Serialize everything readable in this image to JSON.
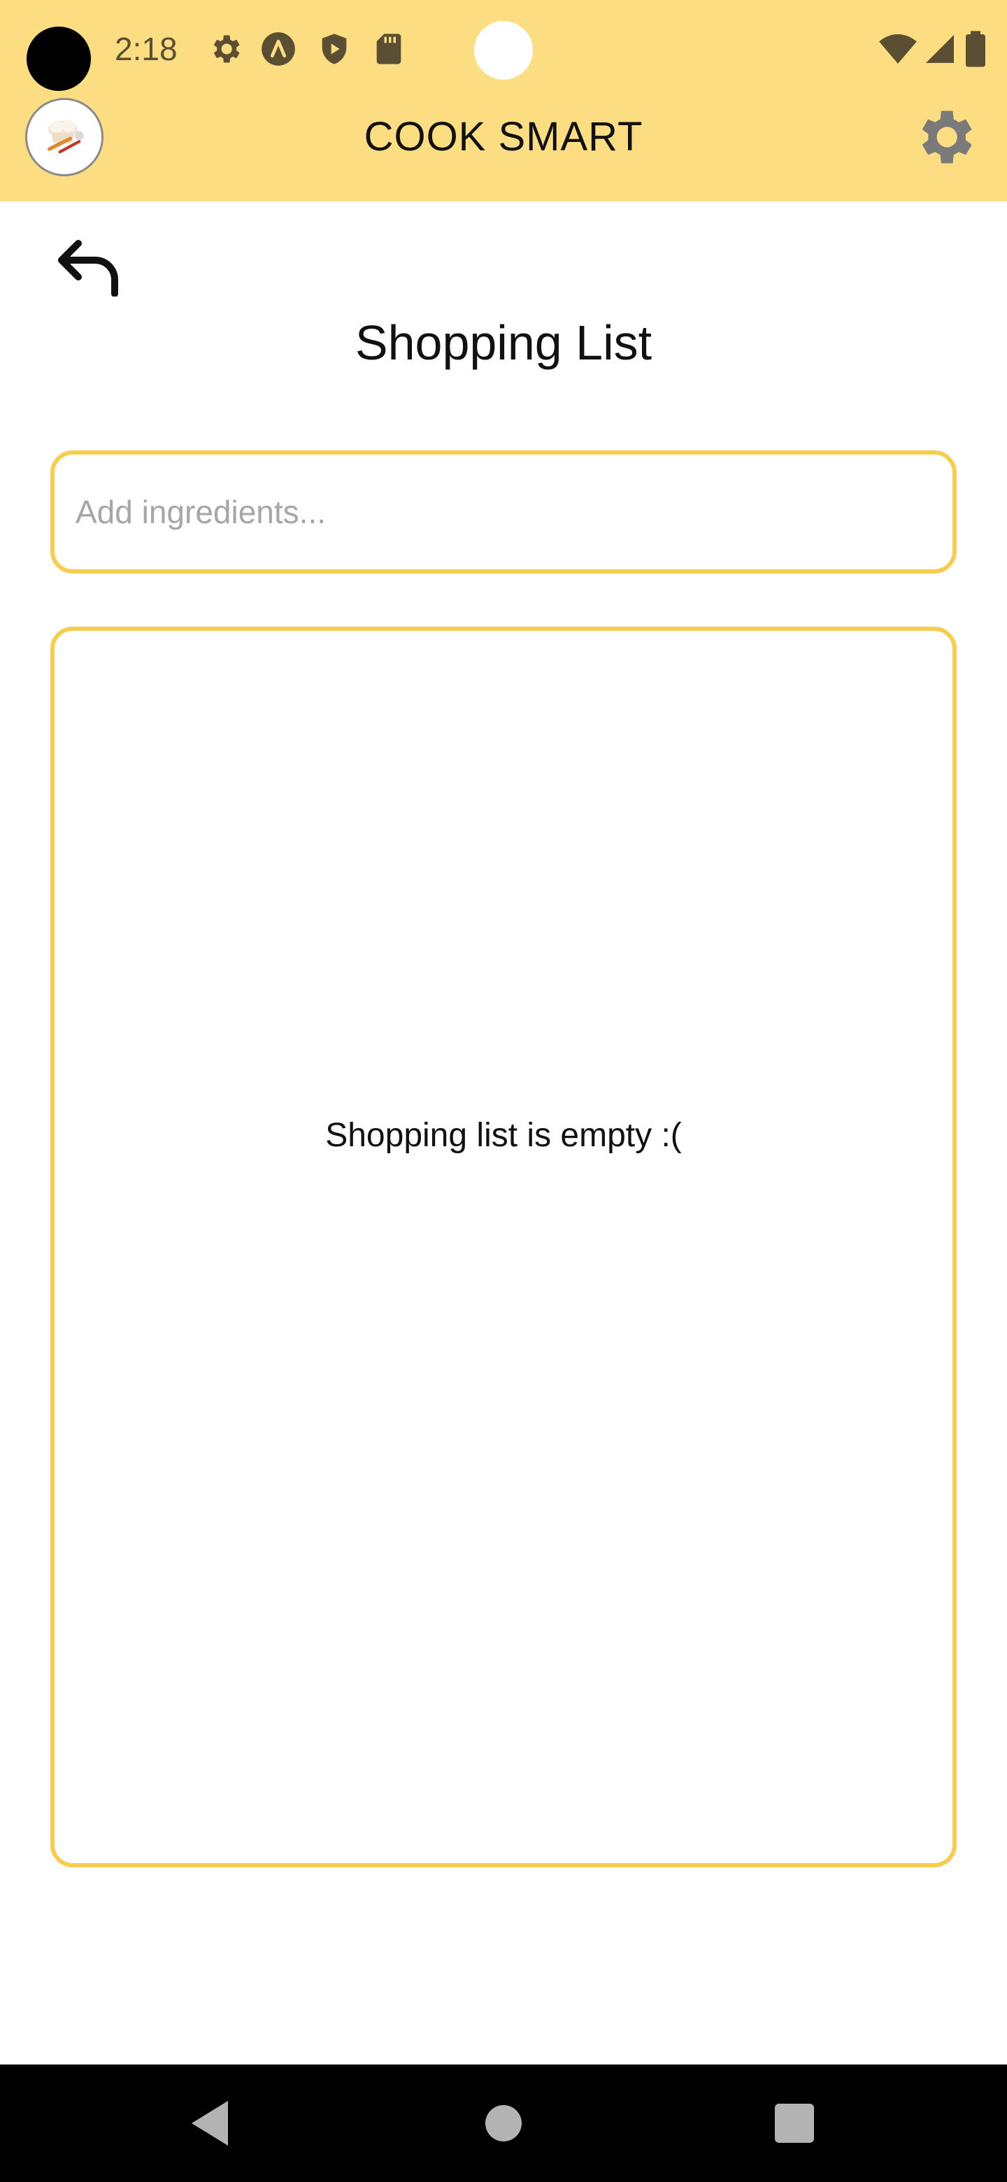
{
  "status_bar": {
    "time": "2:18",
    "icons": [
      "settings-gear-icon",
      "android-a-icon",
      "shield-play-icon",
      "sd-card-icon",
      "wifi-icon",
      "cell-signal-icon",
      "battery-icon"
    ]
  },
  "app_bar": {
    "title": "COOK SMART",
    "avatar_icon": "chef-logo-icon",
    "settings_icon": "gear-icon"
  },
  "page": {
    "back_icon": "back-arrow-icon",
    "title": "Shopping List"
  },
  "ingredient_input": {
    "placeholder": "Add ingredients...",
    "value": ""
  },
  "shopping_list": {
    "items": [],
    "empty_message": "Shopping list is empty :("
  },
  "nav_bar": {
    "buttons": [
      "back-triangle-icon",
      "home-circle-icon",
      "recents-square-icon"
    ]
  },
  "colors": {
    "header_background": "#fddd81",
    "accent_border": "#f8cd4f",
    "nav_background": "#000000"
  }
}
